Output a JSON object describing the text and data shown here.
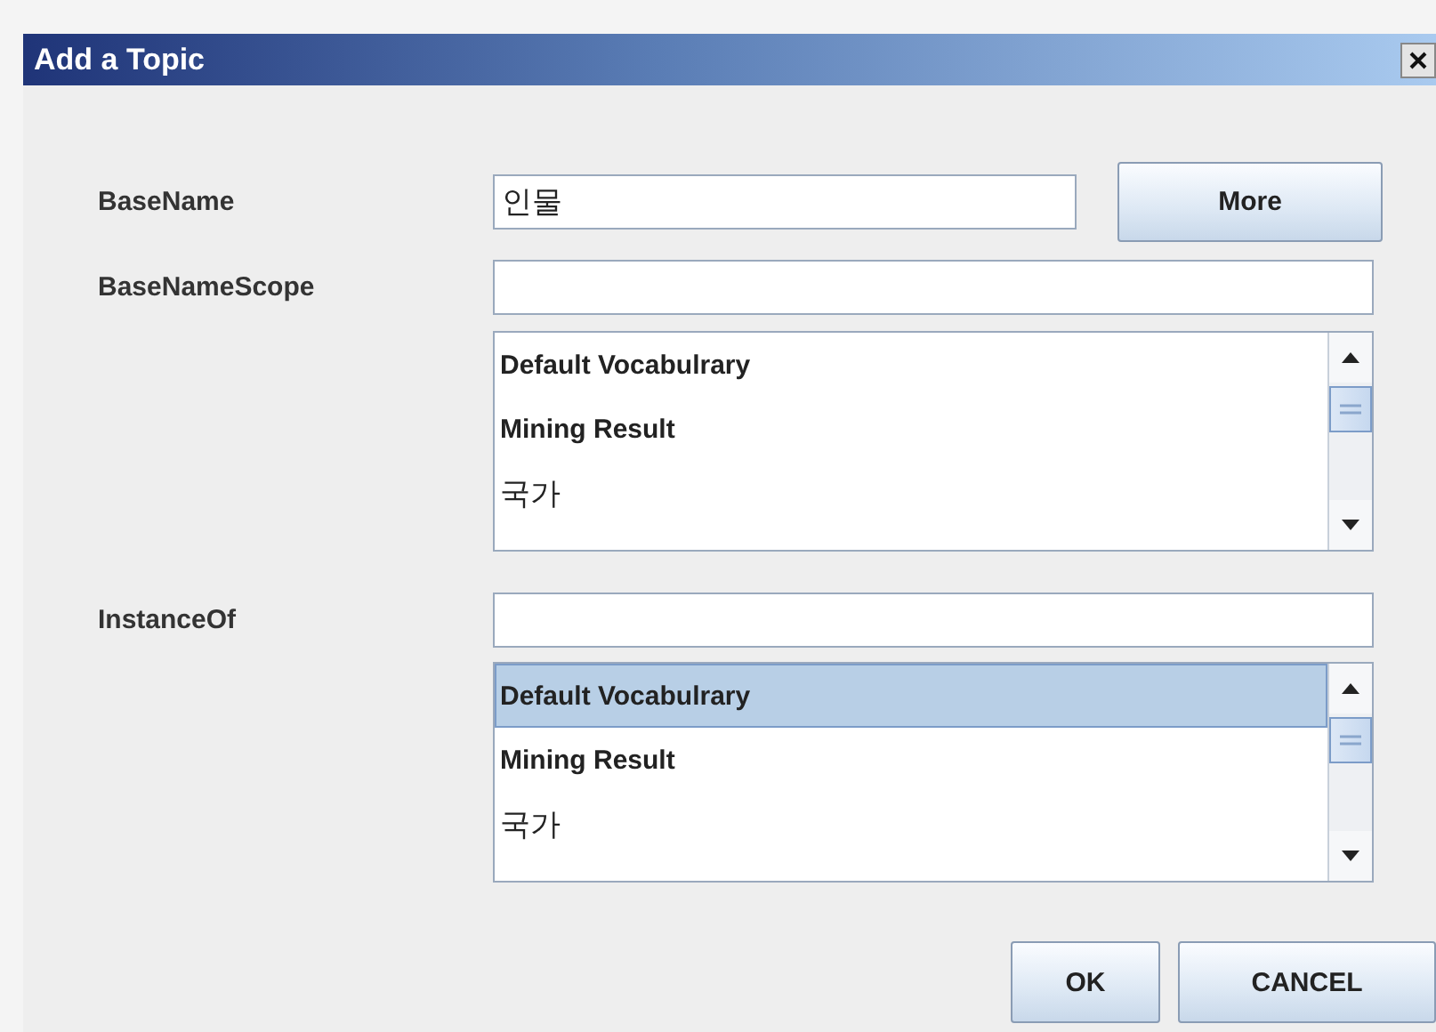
{
  "window": {
    "title": "Add a Topic"
  },
  "rows": [
    {
      "kind": "input",
      "label": "BaseName",
      "value": "인물",
      "button": "More"
    },
    {
      "kind": "input",
      "label": "BaseNameScope"
    },
    {
      "kind": "list",
      "items": [
        {
          "text": "Default Vocabulrary",
          "selected": false
        },
        {
          "text": "Mining Result",
          "selected": false
        },
        {
          "text": "국가",
          "selected": false
        }
      ]
    },
    {
      "kind": "input",
      "label": "InstanceOf"
    },
    {
      "kind": "list",
      "items": [
        {
          "text": "Default Vocabulrary",
          "selected": true
        },
        {
          "text": "Mining Result",
          "selected": false
        },
        {
          "text": "국가",
          "selected": false
        }
      ]
    }
  ],
  "buttons": [
    "OK",
    "CANCEL"
  ]
}
